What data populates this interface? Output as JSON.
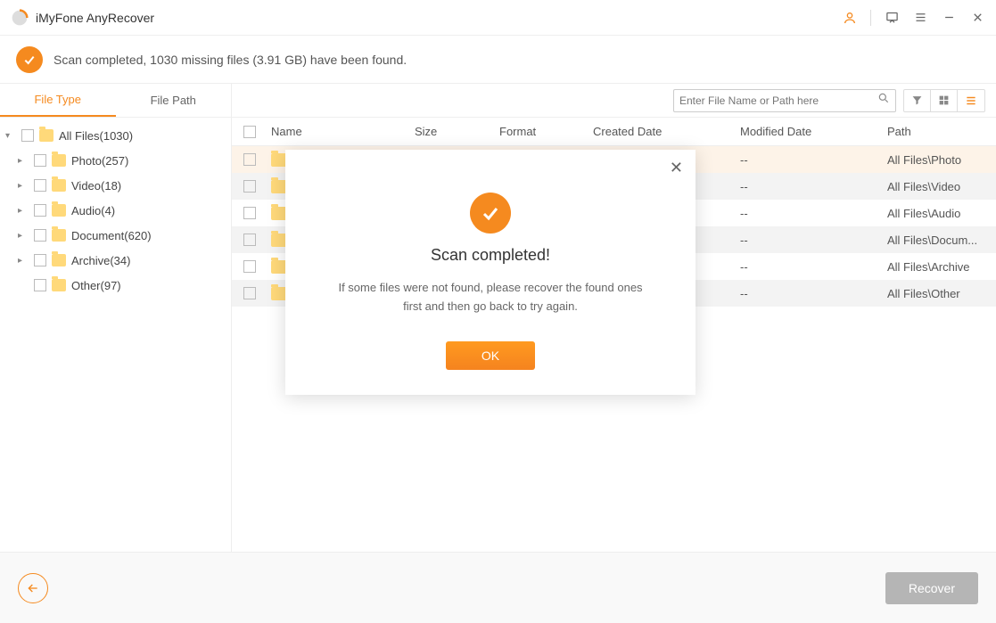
{
  "app": {
    "title": "iMyFone AnyRecover"
  },
  "status": {
    "message": "Scan completed, 1030 missing files (3.91 GB) have been found."
  },
  "tabs": {
    "file_type": "File Type",
    "file_path": "File Path"
  },
  "tree": {
    "root": "All Files(1030)",
    "items": [
      "Photo(257)",
      "Video(18)",
      "Audio(4)",
      "Document(620)",
      "Archive(34)",
      "Other(97)"
    ]
  },
  "search": {
    "placeholder": "Enter File Name or Path here"
  },
  "columns": {
    "name": "Name",
    "size": "Size",
    "format": "Format",
    "created": "Created Date",
    "modified": "Modified Date",
    "path": "Path"
  },
  "rows": [
    {
      "name": "",
      "size": "",
      "format": "",
      "created": "",
      "modified": "--",
      "path": "All Files\\Photo"
    },
    {
      "name": "",
      "size": "",
      "format": "",
      "created": "",
      "modified": "--",
      "path": "All Files\\Video"
    },
    {
      "name": "",
      "size": "",
      "format": "",
      "created": "",
      "modified": "--",
      "path": "All Files\\Audio"
    },
    {
      "name": "",
      "size": "",
      "format": "",
      "created": "",
      "modified": "--",
      "path": "All Files\\Docum..."
    },
    {
      "name": "",
      "size": "",
      "format": "",
      "created": "",
      "modified": "--",
      "path": "All Files\\Archive"
    },
    {
      "name": "",
      "size": "",
      "format": "",
      "created": "",
      "modified": "--",
      "path": "All Files\\Other"
    }
  ],
  "footer": {
    "recover": "Recover"
  },
  "modal": {
    "title": "Scan completed!",
    "text": "If some files were not found, please recover the found ones first and then go back to try again.",
    "ok": "OK"
  }
}
